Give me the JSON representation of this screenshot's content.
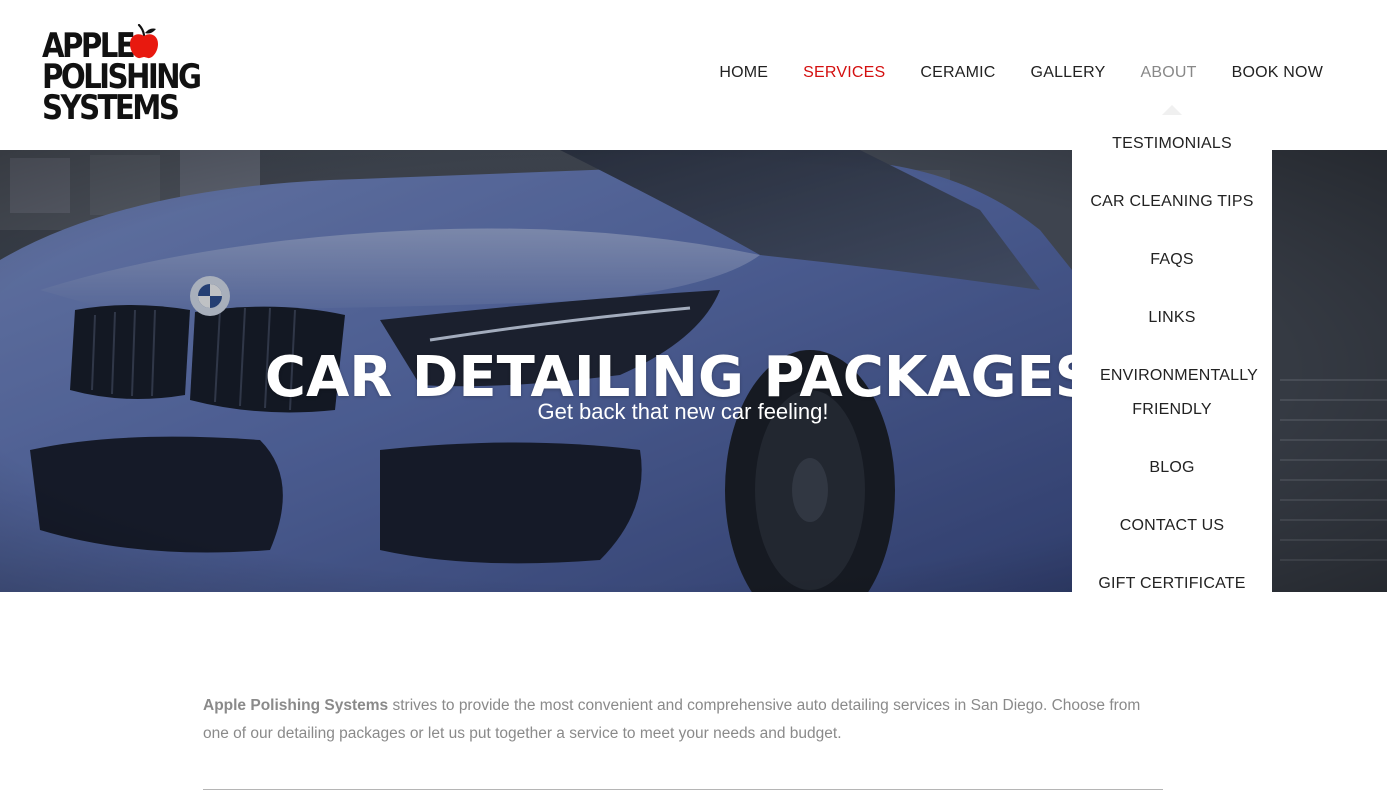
{
  "brand": {
    "logo_lines": [
      "APPLE",
      "POLISHING",
      "SYSTEMS"
    ],
    "logo_icon": "apple-icon",
    "logo_icon_color": "#e8190f"
  },
  "nav": {
    "items": [
      "HOME",
      "SERVICES",
      "CERAMIC",
      "GALLERY",
      "ABOUT",
      "BOOK NOW"
    ],
    "active": "SERVICES",
    "hovered": "ABOUT",
    "active_color": "#d40f0f"
  },
  "about_menu": {
    "items": [
      "TESTIMONIALS",
      "CAR CLEANING TIPS",
      "FAQS",
      "LINKS",
      "ENVIRONMENTALLY FRIENDLY",
      "BLOG",
      "CONTACT US",
      "GIFT CERTIFICATE"
    ]
  },
  "hero": {
    "title": "CAR DETAILING PACKAGES",
    "subtitle": "Get back that new car feeling!"
  },
  "intro": {
    "company": "Apple Polishing Systems",
    "text": " strives to provide the most convenient and comprehensive auto detailing services in San Diego. Choose from one of our detailing packages or let us put together a service to meet your needs and budget."
  }
}
